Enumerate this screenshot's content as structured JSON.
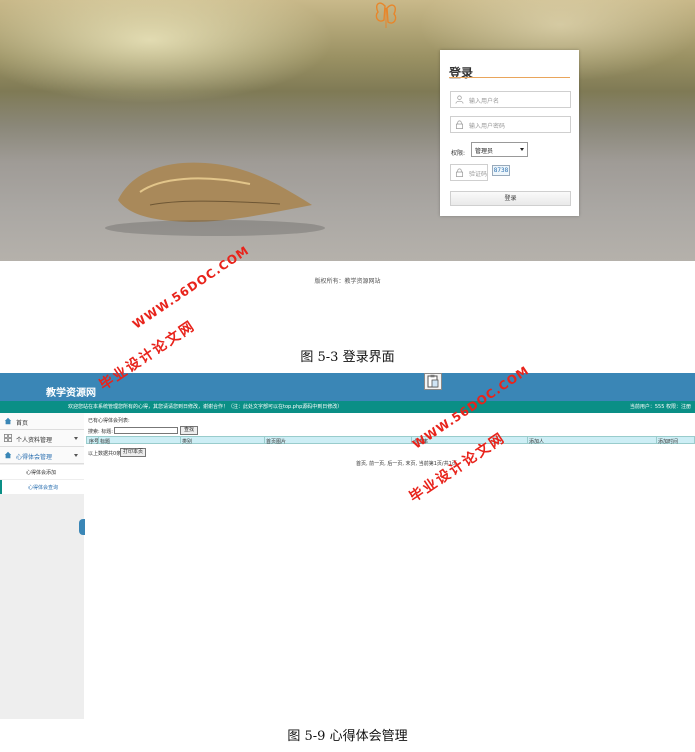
{
  "login": {
    "title": "登录",
    "username_placeholder": "输入用户名",
    "password_placeholder": "输入用户密码",
    "role_label": "权限:",
    "role_value": "管理员",
    "captcha_placeholder": "验证码",
    "captcha_code": "8738",
    "login_button": "登录",
    "footer": "版权所有：教学资源网站"
  },
  "captions": {
    "login": "图 5-3 登录界面",
    "admin": "图 5-9 心得体会管理"
  },
  "admin": {
    "site_title": "教学资源网",
    "notice": "欢迎您站在本系统管理您所有的心得，其您请请您到日修改，谢谢合作！（注：此处文字部可以在top.php源码中到日修改）",
    "user_info": "当前用户：555  权限：注册",
    "sidebar": [
      {
        "label": "首页",
        "icon": "home-icon"
      },
      {
        "label": "个人资料管理",
        "icon": "grid-icon"
      },
      {
        "label": "心得体会管理",
        "icon": "home-icon",
        "open": true
      }
    ],
    "submenu": [
      {
        "label": "心得体会添加"
      },
      {
        "label": "心得体会查询",
        "active": true
      }
    ],
    "content_heading": "已有心得体会列表:",
    "search_label": "搜索: 标题:",
    "search_button": "查找",
    "columns": [
      "序号",
      "标题",
      "类别",
      "首页图片",
      "点击率",
      "添加人",
      "添加时间"
    ],
    "selected_count": "以上数据共0条,",
    "print_button": "打印本页",
    "pagination": "首页, 前一页, 后一页, 末页, 当前第1页/共1页"
  },
  "watermarks": {
    "site": "WWW.56DOC.COM",
    "brand": "毕业设计论文网"
  },
  "colors": {
    "header_blue": "#3a86b6",
    "bar_teal": "#0a8f86",
    "watermark_red": "#e8231b",
    "login_accent": "#e9a55b"
  }
}
